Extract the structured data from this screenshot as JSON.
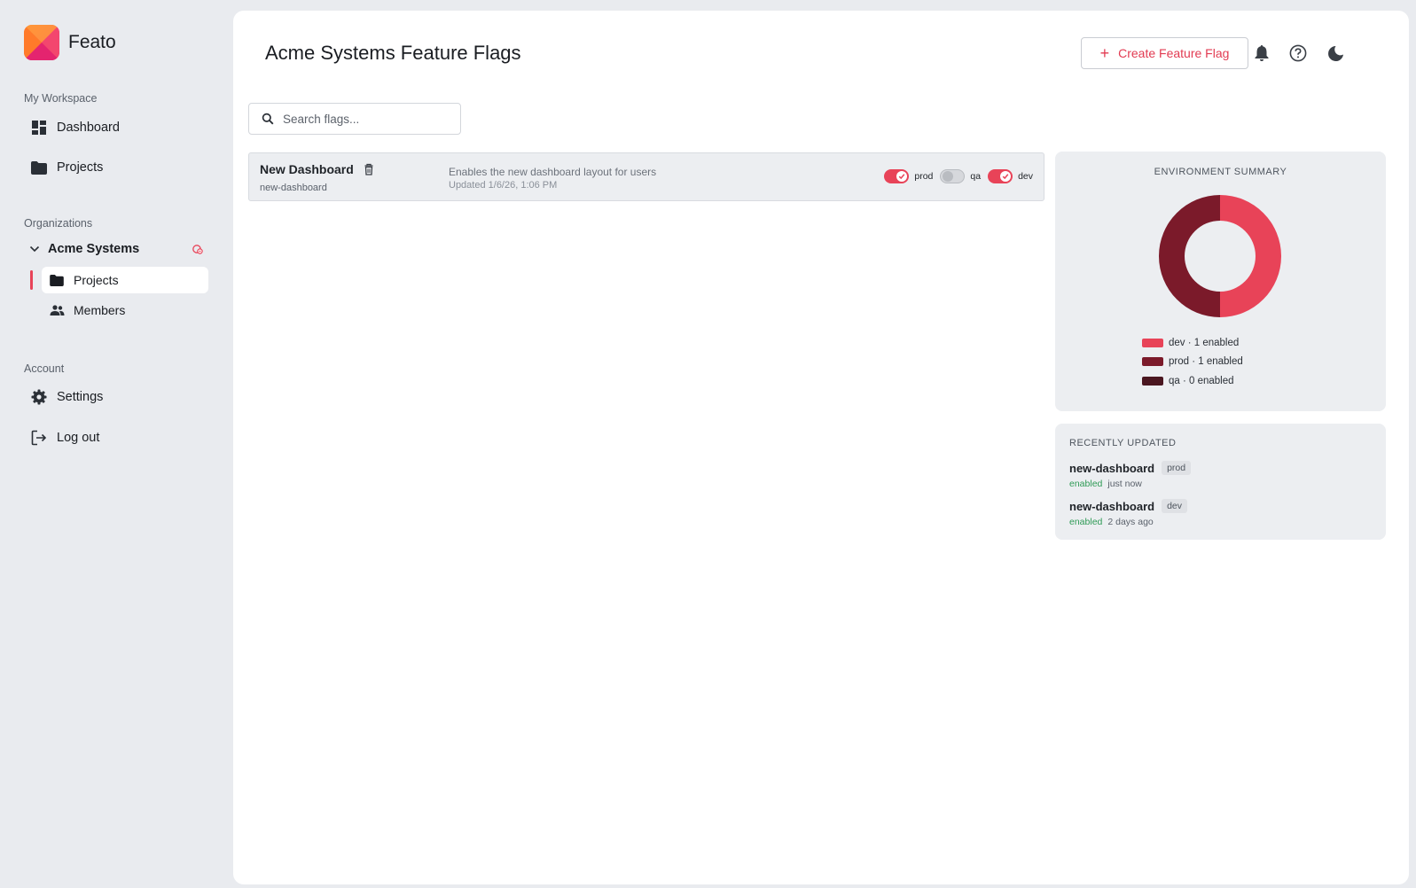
{
  "brand": {
    "name": "Feato"
  },
  "sidebar": {
    "workspace_label": "My Workspace",
    "workspace_items": [
      {
        "label": "Dashboard",
        "icon": "dashboard-icon"
      },
      {
        "label": "Projects",
        "icon": "folder-icon"
      }
    ],
    "organizations_label": "Organizations",
    "organization": {
      "name": "Acme Systems",
      "sub_items": [
        {
          "label": "Projects",
          "icon": "folder-icon",
          "active": true
        },
        {
          "label": "Members",
          "icon": "people-icon",
          "active": false
        }
      ]
    },
    "account_label": "Account",
    "account_items": [
      {
        "label": "Settings",
        "icon": "gear-icon"
      },
      {
        "label": "Log out",
        "icon": "logout-icon"
      }
    ]
  },
  "header": {
    "title": "Acme Systems Feature Flags",
    "create_label": "Create Feature Flag"
  },
  "search": {
    "placeholder": "Search flags..."
  },
  "flags": [
    {
      "name": "New Dashboard",
      "key": "new-dashboard",
      "description": "Enables the new dashboard layout for users",
      "updated": "Updated 1/6/26, 1:06 PM",
      "environments": [
        {
          "name": "prod",
          "enabled": true
        },
        {
          "name": "qa",
          "enabled": false
        },
        {
          "name": "dev",
          "enabled": true
        }
      ]
    }
  ],
  "env_summary": {
    "title": "ENVIRONMENT SUMMARY",
    "legend": [
      {
        "text": "dev · 1 enabled",
        "color": "#e84358"
      },
      {
        "text": "prod · 1 enabled",
        "color": "#7b1a2a"
      },
      {
        "text": "qa · 0 enabled",
        "color": "#4a1620"
      }
    ]
  },
  "chart_data": {
    "type": "pie",
    "categories": [
      "dev",
      "prod",
      "qa"
    ],
    "values": [
      1,
      1,
      0
    ],
    "colors": [
      "#e84358",
      "#7b1a2a",
      "#4a1620"
    ],
    "title": "ENVIRONMENT SUMMARY"
  },
  "recent": {
    "title": "RECENTLY UPDATED",
    "items": [
      {
        "key": "new-dashboard",
        "env": "prod",
        "status": "enabled",
        "when": "just now"
      },
      {
        "key": "new-dashboard",
        "env": "dev",
        "status": "enabled",
        "when": "2 days ago"
      }
    ]
  },
  "colors": {
    "accent": "#e84358",
    "sidebar_bg": "#e9ebef",
    "card_bg": "#eceef1",
    "enabled_green": "#2e9a55"
  }
}
